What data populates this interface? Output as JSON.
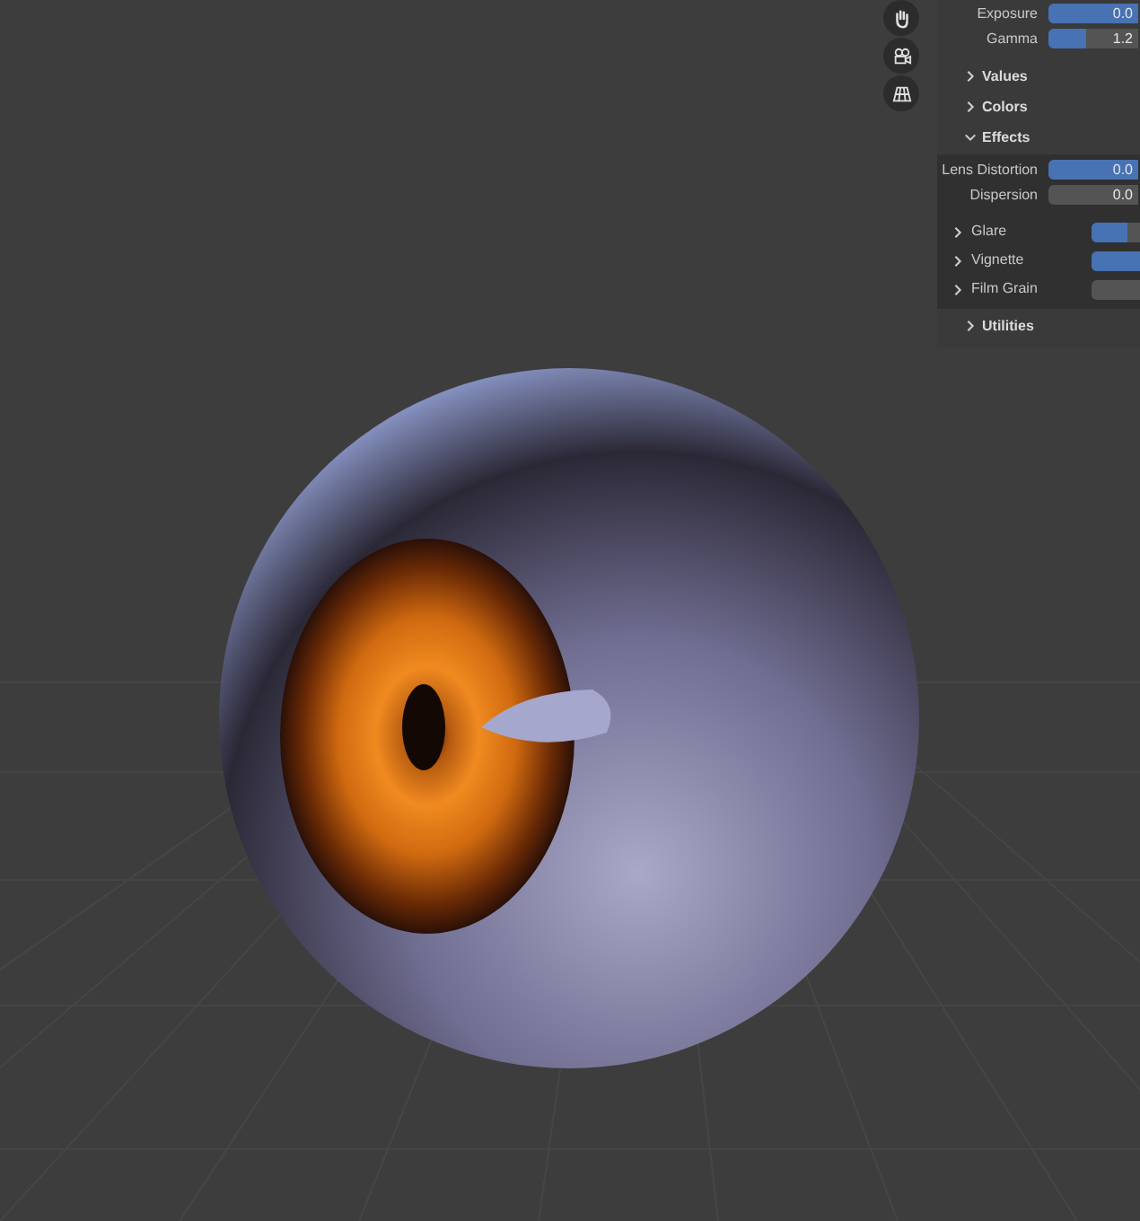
{
  "panel": {
    "fields": [
      {
        "label": "Exposure",
        "value": "0.0",
        "level": 1
      },
      {
        "label": "Gamma",
        "value": "1.2",
        "level": 0.42
      }
    ],
    "sections": [
      {
        "label": "Values",
        "expanded": false
      },
      {
        "label": "Colors",
        "expanded": false
      },
      {
        "label": "Effects",
        "expanded": true,
        "fields": [
          {
            "label": "Lens Distortion",
            "value": "0.0",
            "level": 1
          },
          {
            "label": "Dispersion",
            "value": "0.0",
            "level": 0
          }
        ],
        "subpanels": [
          {
            "label": "Glare",
            "expanded": false,
            "level": 0.75
          },
          {
            "label": "Vignette",
            "expanded": false,
            "level": 1
          },
          {
            "label": "Film Grain",
            "expanded": false,
            "level": 0
          }
        ]
      },
      {
        "label": "Utilities",
        "expanded": false
      }
    ]
  }
}
